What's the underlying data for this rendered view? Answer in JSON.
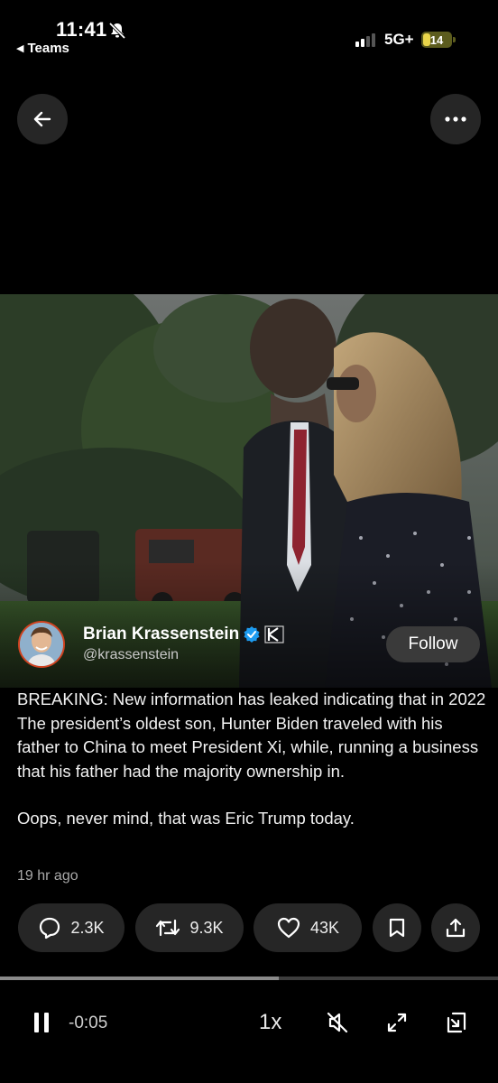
{
  "status_bar": {
    "time": "11:41",
    "back_app": "Teams",
    "network": "5G+",
    "battery": "14",
    "signal_bars_active": 2,
    "signal_bars_total": 4
  },
  "icons": {
    "top_left": "back-arrow-icon",
    "top_right": "more-options-icon",
    "verified": "verified-badge-icon",
    "affiliate": "affiliate-k-logo",
    "reply": "reply-icon",
    "retweet": "retweet-icon",
    "like": "heart-icon",
    "bookmark": "bookmark-icon",
    "share": "share-icon",
    "pause": "pause-icon",
    "mute": "muted-speaker-icon",
    "fullscreen": "expand-icon",
    "pip": "picture-in-picture-icon"
  },
  "author": {
    "name": "Brian Krassenstein",
    "handle": "@krassenstein",
    "follow_label": "Follow"
  },
  "tweet": {
    "paragraphs": [
      "BREAKING: New information has leaked indicating that in 2022 The president’s oldest son, Hunter Biden traveled with his father to China to meet President Xi, while, running a business that his father had the majority ownership in.",
      "Oops, never mind, that was Eric Trump today."
    ],
    "timestamp": "19 hr ago"
  },
  "actions": {
    "replies": "2.3K",
    "retweets": "9.3K",
    "likes": "43K"
  },
  "player": {
    "progress_fraction": 0.56,
    "remaining": "-0:05",
    "speed": "1x"
  },
  "colors": {
    "background": "#000000",
    "pill": "#262626",
    "verified": "#1d9bf0",
    "avatar_ring": "#d0421f",
    "battery_fill": "#e9d54a"
  }
}
